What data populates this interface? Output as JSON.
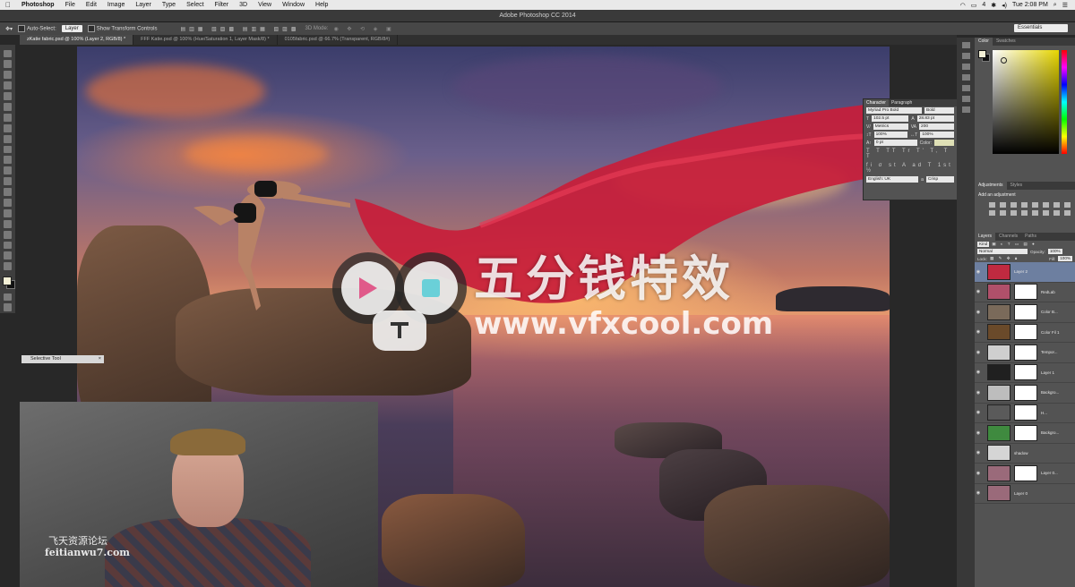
{
  "menubar": {
    "apple": "",
    "app": "Photoshop",
    "items": [
      "File",
      "Edit",
      "Image",
      "Layer",
      "Type",
      "Select",
      "Filter",
      "3D",
      "View",
      "Window",
      "Help"
    ],
    "status_right": {
      "battery": "4",
      "clock": "Tue 2:08 PM"
    }
  },
  "titlebar": {
    "title": "Adobe Photoshop CC 2014"
  },
  "options": {
    "auto_select_label": "Auto-Select:",
    "auto_select_value": "Layer",
    "transform_label": "Show Transform Controls",
    "mode_3d": "3D Mode:",
    "workspace": "Essentials"
  },
  "tabs": [
    {
      "label": "zKatie fabric.psd @ 100% (Layer 2, RGB/8) *",
      "active": true
    },
    {
      "label": "FFF Katie.psd @ 100% (Hue/Saturation 1, Layer Mask/8) *",
      "active": false
    },
    {
      "label": "0105fabric.psd @ 66.7% (Transparent, RGB/8#)",
      "active": false
    }
  ],
  "watermark": {
    "cn": "五分钱特效",
    "url": "www.vfxcool.com"
  },
  "selective_tool": {
    "label": "Selective Tool"
  },
  "webcam": {
    "wm_cn": "飞天资源论坛",
    "wm_url": "feitianwu7.com"
  },
  "character": {
    "tabs": [
      "Character",
      "Paragraph"
    ],
    "font_family": "Myriad Pro Bold",
    "font_style": "Bold",
    "size": "102.5 pt",
    "leading": "28.83 pt",
    "kerning": "Metrics",
    "tracking": "200",
    "vscale": "100%",
    "hscale": "100%",
    "baseline": "0 pt",
    "color_label": "Color:",
    "style_buttons": "T T TT Tr T' T, T T",
    "opentype_buttons": "fi σ st A ad T 1st ½",
    "language": "English: UK",
    "aa_label": "a",
    "aa": "Crisp"
  },
  "color_panel": {
    "tabs": [
      "Color",
      "Swatches"
    ],
    "fg": "#f3f0d6",
    "bg": "#111111"
  },
  "adjustments": {
    "tabs": [
      "Adjustments",
      "Styles"
    ],
    "label": "Add an adjustment"
  },
  "layers_panel": {
    "tabs": [
      "Layers",
      "Channels",
      "Paths"
    ],
    "kind": "Kind",
    "blend": "Normal",
    "opacity_label": "Opacity:",
    "opacity": "100%",
    "lock_label": "Lock:",
    "fill_label": "Fill:",
    "fill": "100%",
    "layers": [
      {
        "name": "Layer 2",
        "selected": true,
        "thumb": "#c02a40",
        "mask": false
      },
      {
        "name": "RedLab",
        "selected": false,
        "thumb": "#b0506a",
        "mask": true
      },
      {
        "name": "Color B...",
        "selected": false,
        "thumb": "#7a6a5a",
        "mask": true
      },
      {
        "name": "Color Fil 1",
        "selected": false,
        "thumb": "#6a4a2a",
        "mask": true
      },
      {
        "name": "Tempor...",
        "selected": false,
        "thumb": "#cfcfcf",
        "mask": true
      },
      {
        "name": "Layer 1",
        "selected": false,
        "thumb": "#202020",
        "mask": true
      },
      {
        "name": "Backgro...",
        "selected": false,
        "thumb": "#bdbdbd",
        "mask": true
      },
      {
        "name": "H...",
        "selected": false,
        "thumb": "#5a5a5a",
        "mask": true
      },
      {
        "name": "Backgro...",
        "selected": false,
        "thumb": "#3f8a3f",
        "mask": true
      },
      {
        "name": "shadow",
        "selected": false,
        "thumb": "#d5d5d5",
        "mask": false
      },
      {
        "name": "Layer 0...",
        "selected": false,
        "thumb": "#9a6a7a",
        "mask": true
      },
      {
        "name": "Layer 0",
        "selected": false,
        "thumb": "#9a6a7a",
        "mask": false
      }
    ]
  }
}
